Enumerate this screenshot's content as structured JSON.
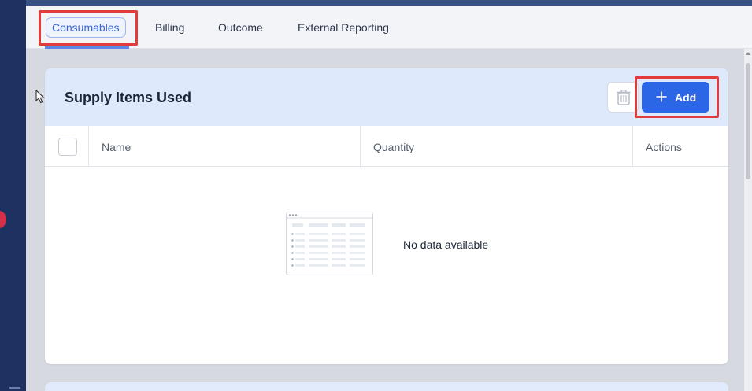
{
  "tabs": [
    {
      "label": "Consumables",
      "active": true
    },
    {
      "label": "Billing",
      "active": false
    },
    {
      "label": "Outcome",
      "active": false
    },
    {
      "label": "External Reporting",
      "active": false
    }
  ],
  "card": {
    "title": "Supply Items Used",
    "delete_icon": "trash-icon",
    "add_label": "Add",
    "add_icon": "plus-icon",
    "columns": [
      "Name",
      "Quantity",
      "Actions"
    ],
    "empty_text": "No data available"
  },
  "colors": {
    "accent": "#2b66e6",
    "header_bg": "#dfe9fc",
    "highlight": "#e23b3b",
    "sidebar": "#1d3260"
  }
}
